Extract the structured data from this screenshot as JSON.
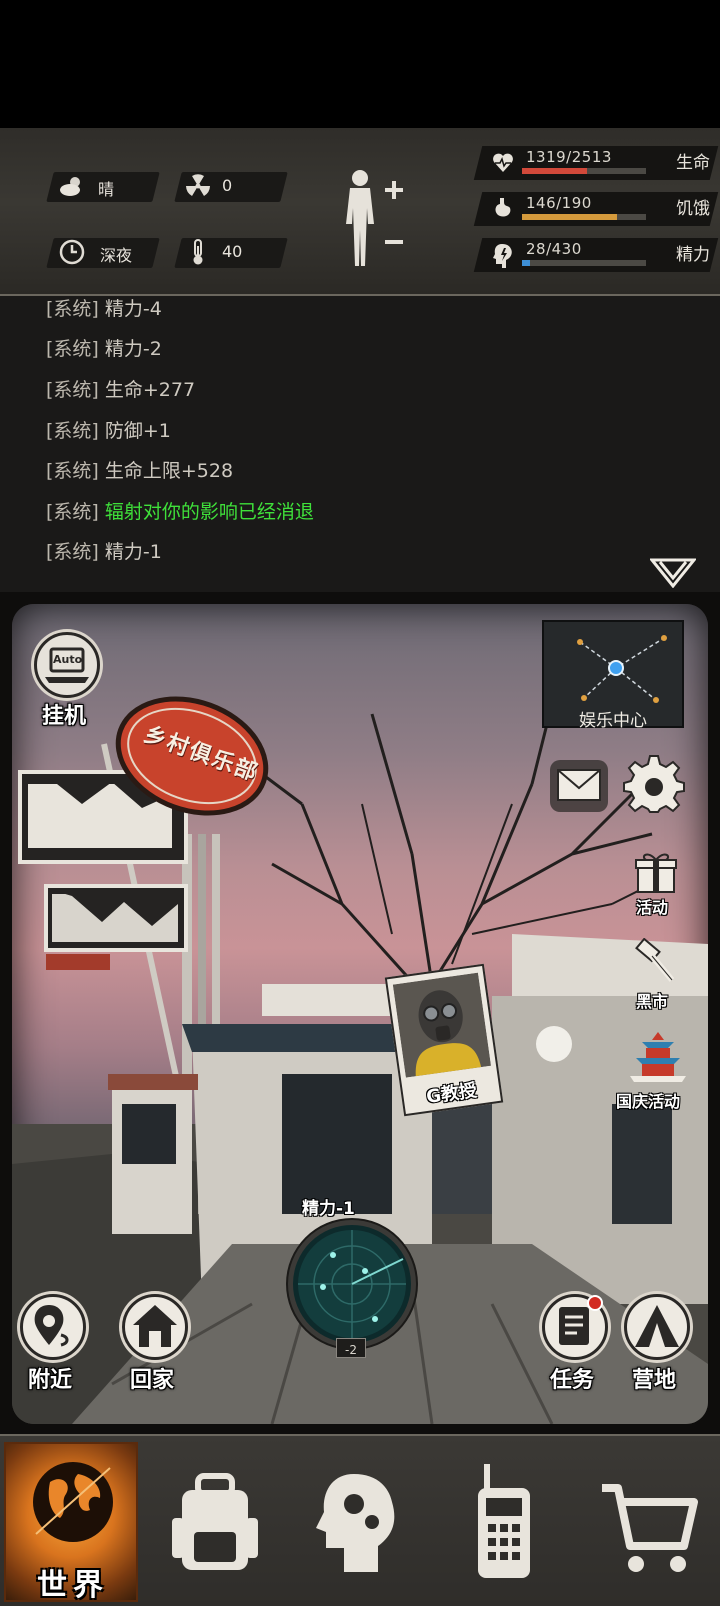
{
  "status": {
    "weather": {
      "icon": "cloudy-sun-icon",
      "label": "晴"
    },
    "radiation": {
      "icon": "radiation-icon",
      "value": "0"
    },
    "time_of_day": {
      "icon": "clock-icon",
      "label": "深夜"
    },
    "temperature": {
      "icon": "thermometer-icon",
      "value": "40"
    },
    "stats": [
      {
        "icon": "heart-icon",
        "value": "1319/2513",
        "name": "生命",
        "fraction": 0.525,
        "color": "#d2493a"
      },
      {
        "icon": "stomach-icon",
        "value": "146/190",
        "name": "饥饿",
        "fraction": 0.768,
        "color": "#d49a3c"
      },
      {
        "icon": "brain-icon",
        "value": "28/430",
        "name": "精力",
        "fraction": 0.065,
        "color": "#3e8fd6"
      }
    ]
  },
  "log": {
    "lines": [
      {
        "tag": "[系统]",
        "msg": "精力-4",
        "highlight": false
      },
      {
        "tag": "[系统]",
        "msg": "精力-2",
        "highlight": false
      },
      {
        "tag": "[系统]",
        "msg": "生命+277",
        "highlight": false
      },
      {
        "tag": "[系统]",
        "msg": "防御+1",
        "highlight": false
      },
      {
        "tag": "[系统]",
        "msg": "生命上限+528",
        "highlight": false
      },
      {
        "tag": "[系统]",
        "msg": "辐射对你的影响已经消退",
        "highlight": true
      },
      {
        "tag": "[系统]",
        "msg": "精力-1",
        "highlight": false
      }
    ]
  },
  "scene": {
    "sign_text": "乡村俱乐部",
    "auto_button": {
      "badge": "Auto",
      "label": "挂机"
    },
    "minimap_label": "娱乐中心",
    "activity_label": "活动",
    "black_market_label": "黑市",
    "national_day_label": "国庆活动",
    "npc_name": "G教授",
    "energy_cost": "精力-1",
    "radar_level": "-2",
    "nearby_label": "附近",
    "home_label": "回家",
    "task_label": "任务",
    "camp_label": "营地"
  },
  "nav": {
    "world_label": "世界"
  }
}
